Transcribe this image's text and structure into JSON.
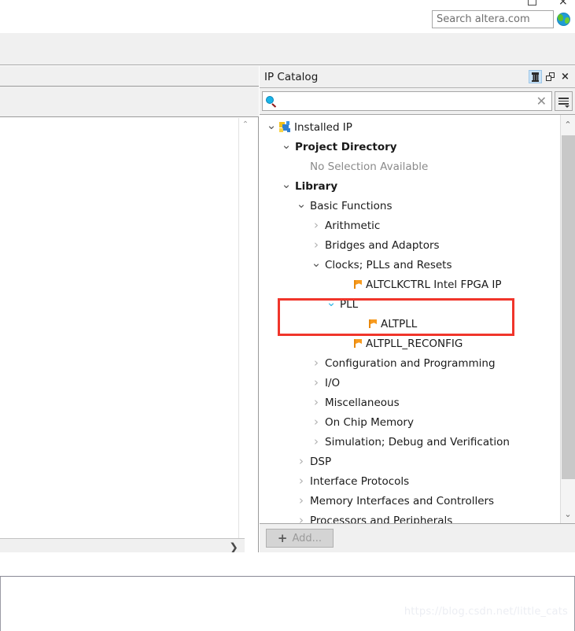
{
  "window": {
    "maximize_label": "maximize",
    "close_label": "×"
  },
  "altera_search": {
    "placeholder": "Search altera.com",
    "value": "",
    "globe_icon": "globe-icon"
  },
  "ip_catalog": {
    "title": "IP Catalog",
    "pin_label": "pin-icon",
    "restore_label": "restore-icon",
    "close_label": "×",
    "search": {
      "placeholder": "",
      "value": "",
      "magnifier_icon": "search-icon",
      "clear_label": "✕",
      "menu_label": "options-menu-icon"
    },
    "tree": [
      {
        "label": "Installed IP",
        "indent": 0,
        "state": "expanded",
        "bold": false,
        "icon": "installed-ip-icon"
      },
      {
        "label": "Project Directory",
        "indent": 1,
        "state": "expanded",
        "bold": true,
        "icon": "none"
      },
      {
        "label": "No Selection Available",
        "indent": 2,
        "state": "none",
        "bold": false,
        "icon": "none",
        "muted": true
      },
      {
        "label": "Library",
        "indent": 1,
        "state": "expanded",
        "bold": true,
        "icon": "none"
      },
      {
        "label": "Basic Functions",
        "indent": 2,
        "state": "expanded",
        "bold": false,
        "icon": "none"
      },
      {
        "label": "Arithmetic",
        "indent": 3,
        "state": "collapsed",
        "bold": false,
        "icon": "none"
      },
      {
        "label": "Bridges and Adaptors",
        "indent": 3,
        "state": "collapsed",
        "bold": false,
        "icon": "none"
      },
      {
        "label": "Clocks; PLLs and Resets",
        "indent": 3,
        "state": "expanded",
        "bold": false,
        "icon": "none"
      },
      {
        "label": "ALTCLKCTRL Intel FPGA IP",
        "indent": 5,
        "state": "none",
        "bold": false,
        "icon": "ip-core-icon"
      },
      {
        "label": "PLL",
        "indent": 4,
        "state": "expanded-cyan",
        "bold": false,
        "icon": "none"
      },
      {
        "label": "ALTPLL",
        "indent": 6,
        "state": "none",
        "bold": false,
        "icon": "ip-core-icon"
      },
      {
        "label": "ALTPLL_RECONFIG",
        "indent": 5,
        "state": "none",
        "bold": false,
        "icon": "ip-core-icon"
      },
      {
        "label": "Configuration and Programming",
        "indent": 3,
        "state": "collapsed",
        "bold": false,
        "icon": "none"
      },
      {
        "label": "I/O",
        "indent": 3,
        "state": "collapsed",
        "bold": false,
        "icon": "none"
      },
      {
        "label": "Miscellaneous",
        "indent": 3,
        "state": "collapsed",
        "bold": false,
        "icon": "none"
      },
      {
        "label": "On Chip Memory",
        "indent": 3,
        "state": "collapsed",
        "bold": false,
        "icon": "none"
      },
      {
        "label": "Simulation; Debug and Verification",
        "indent": 3,
        "state": "collapsed",
        "bold": false,
        "icon": "none"
      },
      {
        "label": "DSP",
        "indent": 2,
        "state": "collapsed",
        "bold": false,
        "icon": "none"
      },
      {
        "label": "Interface Protocols",
        "indent": 2,
        "state": "collapsed",
        "bold": false,
        "icon": "none"
      },
      {
        "label": "Memory Interfaces and Controllers",
        "indent": 2,
        "state": "collapsed",
        "bold": false,
        "icon": "none"
      },
      {
        "label": "Processors and Peripherals",
        "indent": 2,
        "state": "collapsed",
        "bold": false,
        "icon": "none"
      }
    ],
    "highlight": {
      "color": "#f0352b",
      "covers": [
        "PLL",
        "ALTPLL"
      ]
    },
    "add_button": {
      "label": "Add...",
      "plus": "+",
      "enabled": false
    },
    "scroll": {
      "up_arrow": "⌃",
      "down_arrow": "⌄"
    }
  },
  "left_panel": {
    "scroll_up_arrow": "⌃",
    "scroll_down_arrow": "⌄",
    "hscroll_right_arrow": "❯"
  },
  "watermark": {
    "text": "https://blog.csdn.net/little_cats"
  }
}
